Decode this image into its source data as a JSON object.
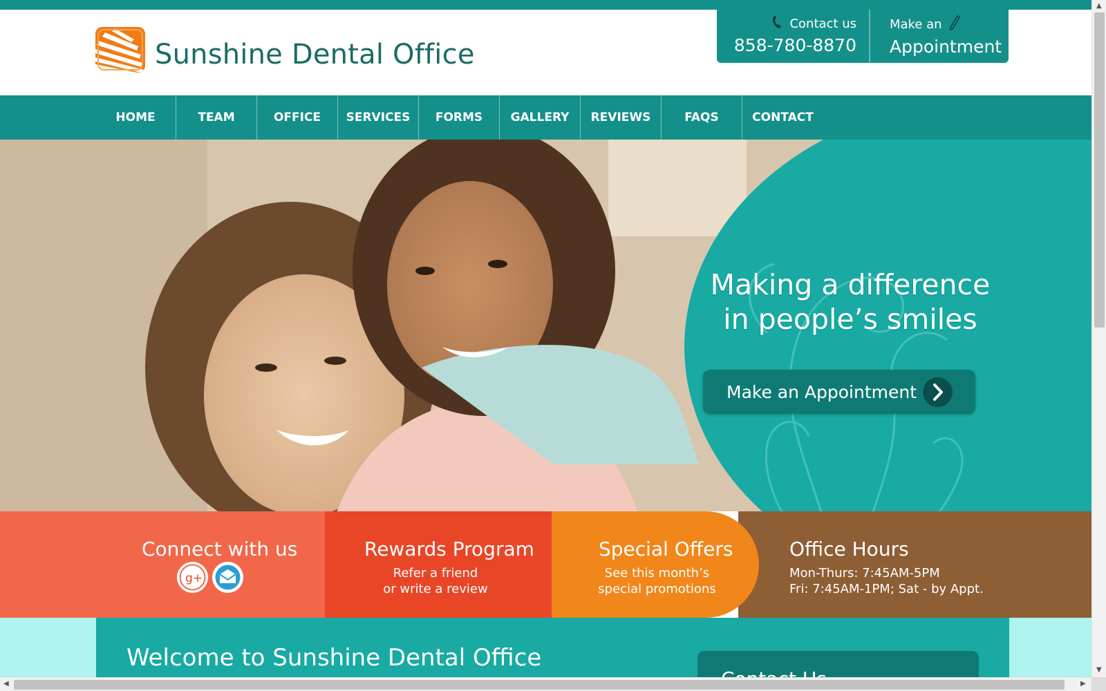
{
  "header": {
    "brand_name": "Sunshine Dental Office",
    "contact_label": "Contact us",
    "phone": "858-780-8870",
    "appointment_small": "Make an",
    "appointment_big": "Appointment"
  },
  "nav": {
    "items": [
      "HOME",
      "TEAM",
      "OFFICE",
      "SERVICES",
      "FORMS",
      "GALLERY",
      "REVIEWS",
      "FAQS",
      "CONTACT"
    ]
  },
  "hero": {
    "headline_line1": "Making a difference",
    "headline_line2": "in people’s smiles",
    "button_label": "Make an Appointment"
  },
  "info_bar": {
    "connect_title": "Connect with us",
    "rewards_title": "Rewards Program",
    "rewards_line1": "Refer a friend",
    "rewards_line2": "or write a review",
    "offers_title": "Special Offers",
    "offers_line1": "See this month’s",
    "offers_line2": "special promotions",
    "hours_title": "Office Hours",
    "hours_line1": "Mon-Thurs: 7:45AM-5PM",
    "hours_line2": "Fri: 7:45AM-1PM; Sat - by Appt."
  },
  "welcome": {
    "title": "Welcome to Sunshine Dental Office",
    "contact_card_title": "Contact Us"
  },
  "colors": {
    "teal": "#14908a",
    "hero_teal": "#18aaa3",
    "coral": "#f2674a",
    "red_orange": "#e94628",
    "orange": "#f1861b",
    "brown": "#8e5e35",
    "logo_orange": "#f07c16"
  },
  "icons": [
    "phone-icon",
    "pen-icon",
    "sun-logo-icon",
    "google-plus-icon",
    "email-icon",
    "chevron-right-icon"
  ]
}
